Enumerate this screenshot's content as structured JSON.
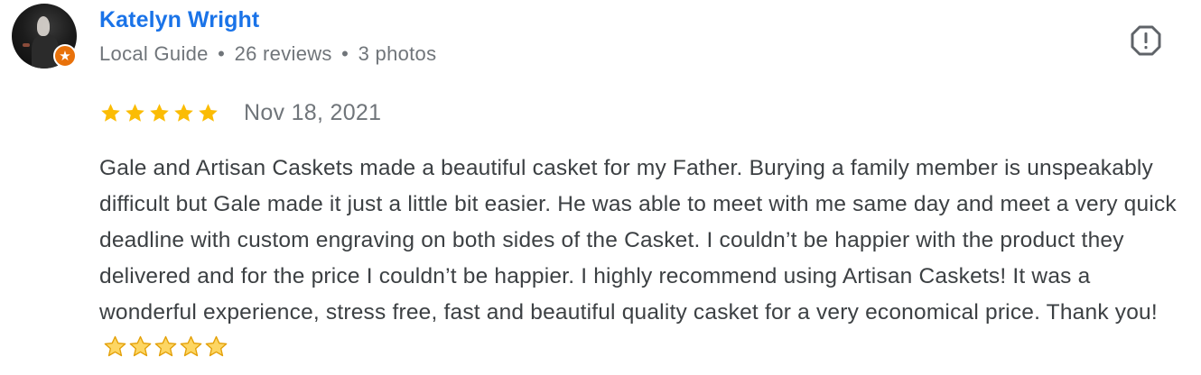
{
  "reviewer": {
    "name": "Katelyn Wright",
    "badge": "Local Guide",
    "reviews": "26 reviews",
    "photos": "3 photos",
    "separator": "•"
  },
  "rating": {
    "stars": 5,
    "max": 5,
    "date": "Nov 18, 2021"
  },
  "review": {
    "text": "Gale and Artisan Caskets made a beautiful casket for my Father. Burying a family member is unspeakably difficult but Gale made it just a little bit easier. He was able to meet with me same day and meet a very quick deadline with custom engraving on both sides of the Casket. I couldn’t be happier with the product they delivered and for the price I couldn’t be happier. I highly recommend using Artisan Caskets! It was a wonderful experience, stress free, fast and beautiful quality casket for a very economical price. Thank you!",
    "trailing_emoji_count": 5
  },
  "icons": {
    "avatar": "avatar",
    "guide_badge": "star-badge-icon",
    "report": "report-flag-icon",
    "rating_star": "star-icon",
    "emoji_star": "star-emoji-icon"
  },
  "colors": {
    "name": "#1a73e8",
    "meta": "#70757a",
    "body": "#3c4043",
    "star": "#fbbc04",
    "badge": "#e8710a",
    "report": "#5f6368"
  }
}
